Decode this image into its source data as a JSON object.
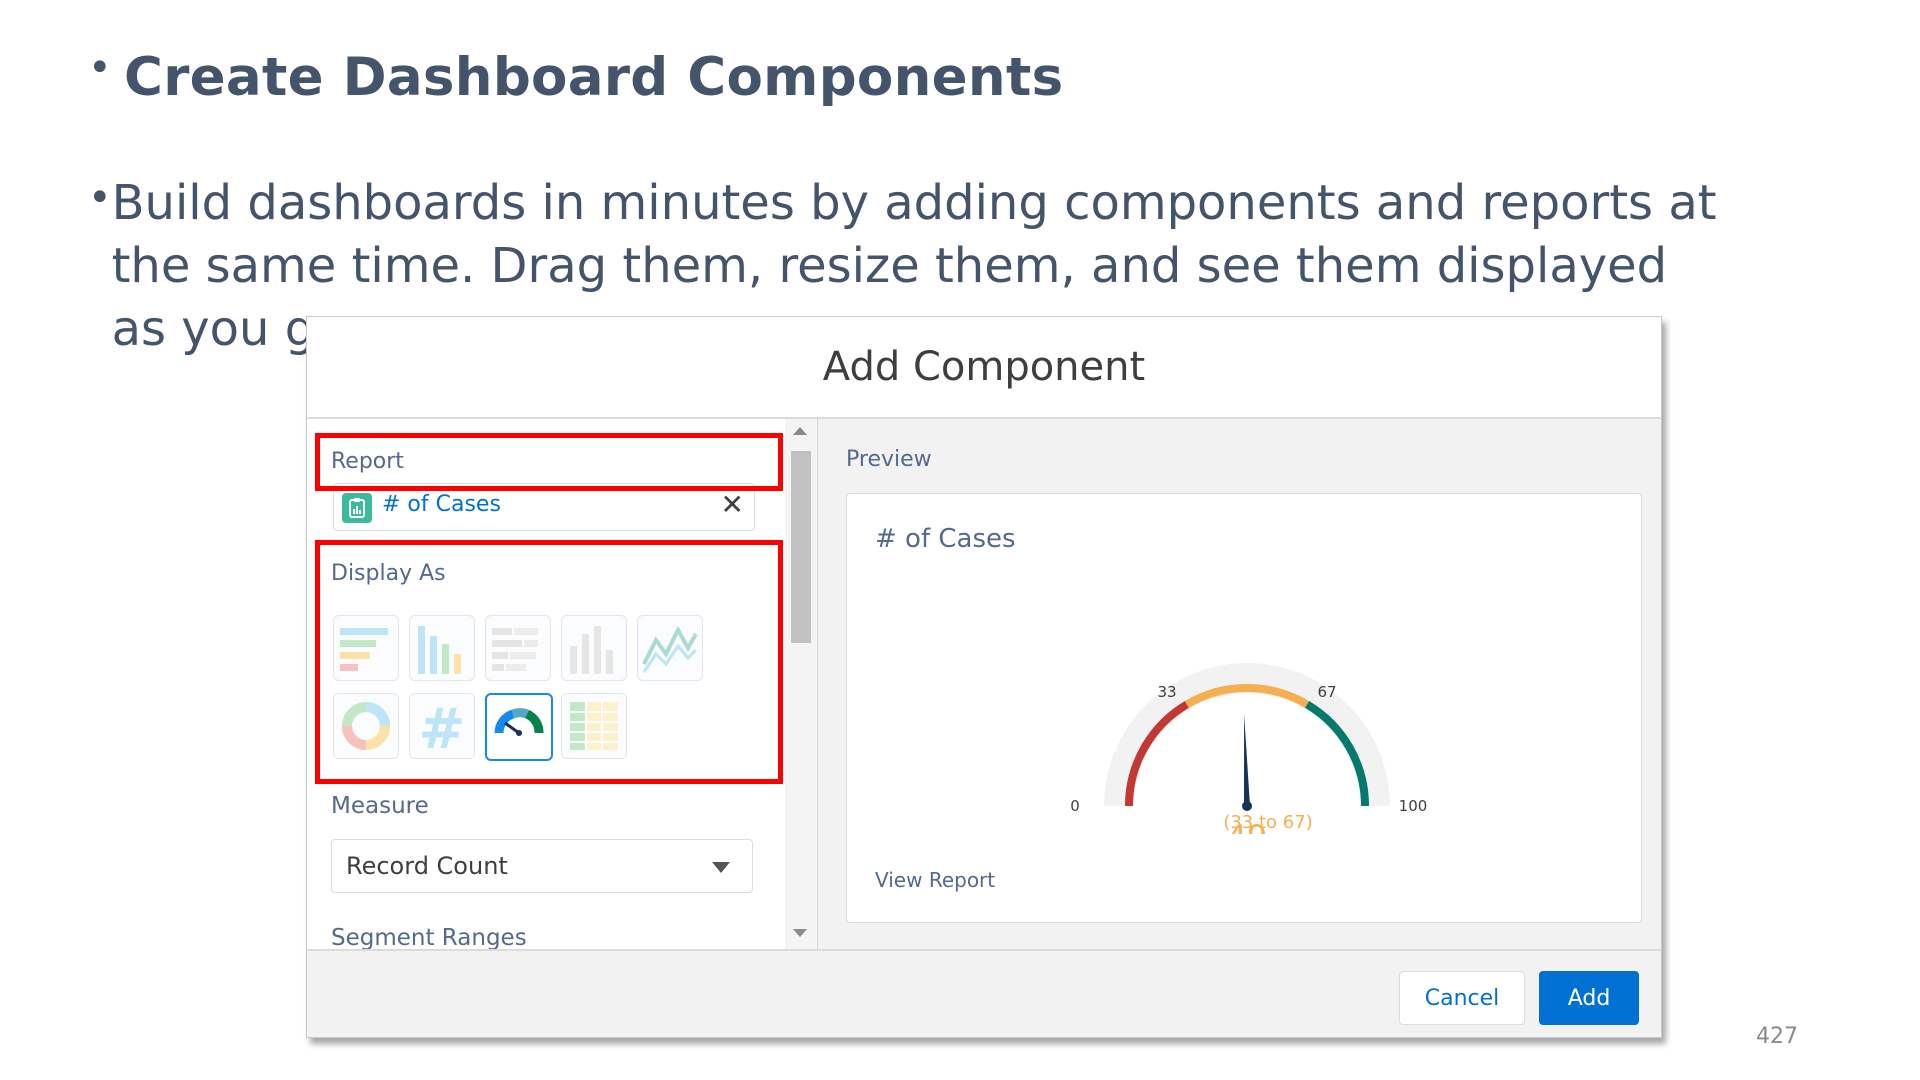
{
  "slide": {
    "title": "Create Dashboard Components",
    "body": "Build dashboards in minutes by adding components and reports at the same time. Drag them, resize them, and see them displayed as you go.",
    "page_number": "427"
  },
  "modal": {
    "title": "Add Component",
    "report_label": "Report",
    "report_value": "# of Cases",
    "display_as_label": "Display As",
    "chart_types": [
      "horizontal-bar",
      "vertical-bar",
      "stacked-horizontal-bar",
      "stacked-vertical-bar",
      "line",
      "donut",
      "metric",
      "gauge",
      "table"
    ],
    "selected_chart_type": "gauge",
    "measure_label": "Measure",
    "measure_value": "Record Count",
    "segment_ranges_label": "Segment Ranges",
    "preview_label": "Preview",
    "preview_card": {
      "title": "# of Cases",
      "view_report": "View Report",
      "gauge": {
        "min_label": "0",
        "breakpoint1_label": "33",
        "breakpoint2_label": "67",
        "max_label": "100",
        "value": "49",
        "range_label": "(33 to 67)",
        "value_numeric": 49,
        "segment_colors": [
          "#c23934",
          "#f5ae50",
          "#047a6e"
        ],
        "value_color": "#f5ae50"
      }
    },
    "cancel_label": "Cancel",
    "add_label": "Add",
    "highlight_color": "#ff0000",
    "accent_color": "#0070d2"
  }
}
